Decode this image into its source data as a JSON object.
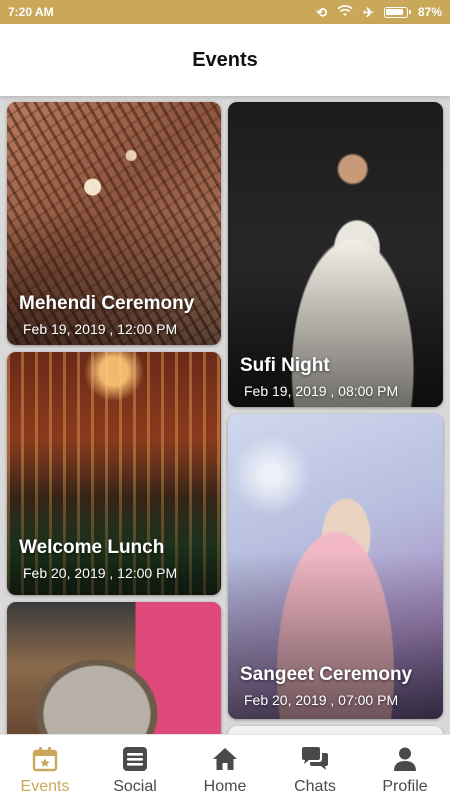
{
  "status_bar": {
    "time": "7:20 AM",
    "battery": "87%",
    "icons": [
      "sync-off-icon",
      "wifi-icon",
      "airplane-icon",
      "battery-icon"
    ]
  },
  "header": {
    "title": "Events"
  },
  "events": [
    {
      "title": "Mehendi Ceremony",
      "date": "Feb 19, 2019 , 12:00 PM"
    },
    {
      "title": "Sufi Night",
      "date": "Feb 19, 2019 , 08:00 PM"
    },
    {
      "title": "Welcome Lunch",
      "date": "Feb 20, 2019 , 12:00 PM"
    },
    {
      "title": "Sangeet Ceremony",
      "date": "Feb 20, 2019 , 07:00 PM"
    }
  ],
  "bottom_nav": {
    "active": "Events",
    "accent_color": "#c9a85a",
    "items": [
      {
        "label": "Events",
        "icon": "calendar-star-icon"
      },
      {
        "label": "Social",
        "icon": "list-icon"
      },
      {
        "label": "Home",
        "icon": "home-icon"
      },
      {
        "label": "Chats",
        "icon": "chat-icon"
      },
      {
        "label": "Profile",
        "icon": "person-icon"
      }
    ]
  }
}
